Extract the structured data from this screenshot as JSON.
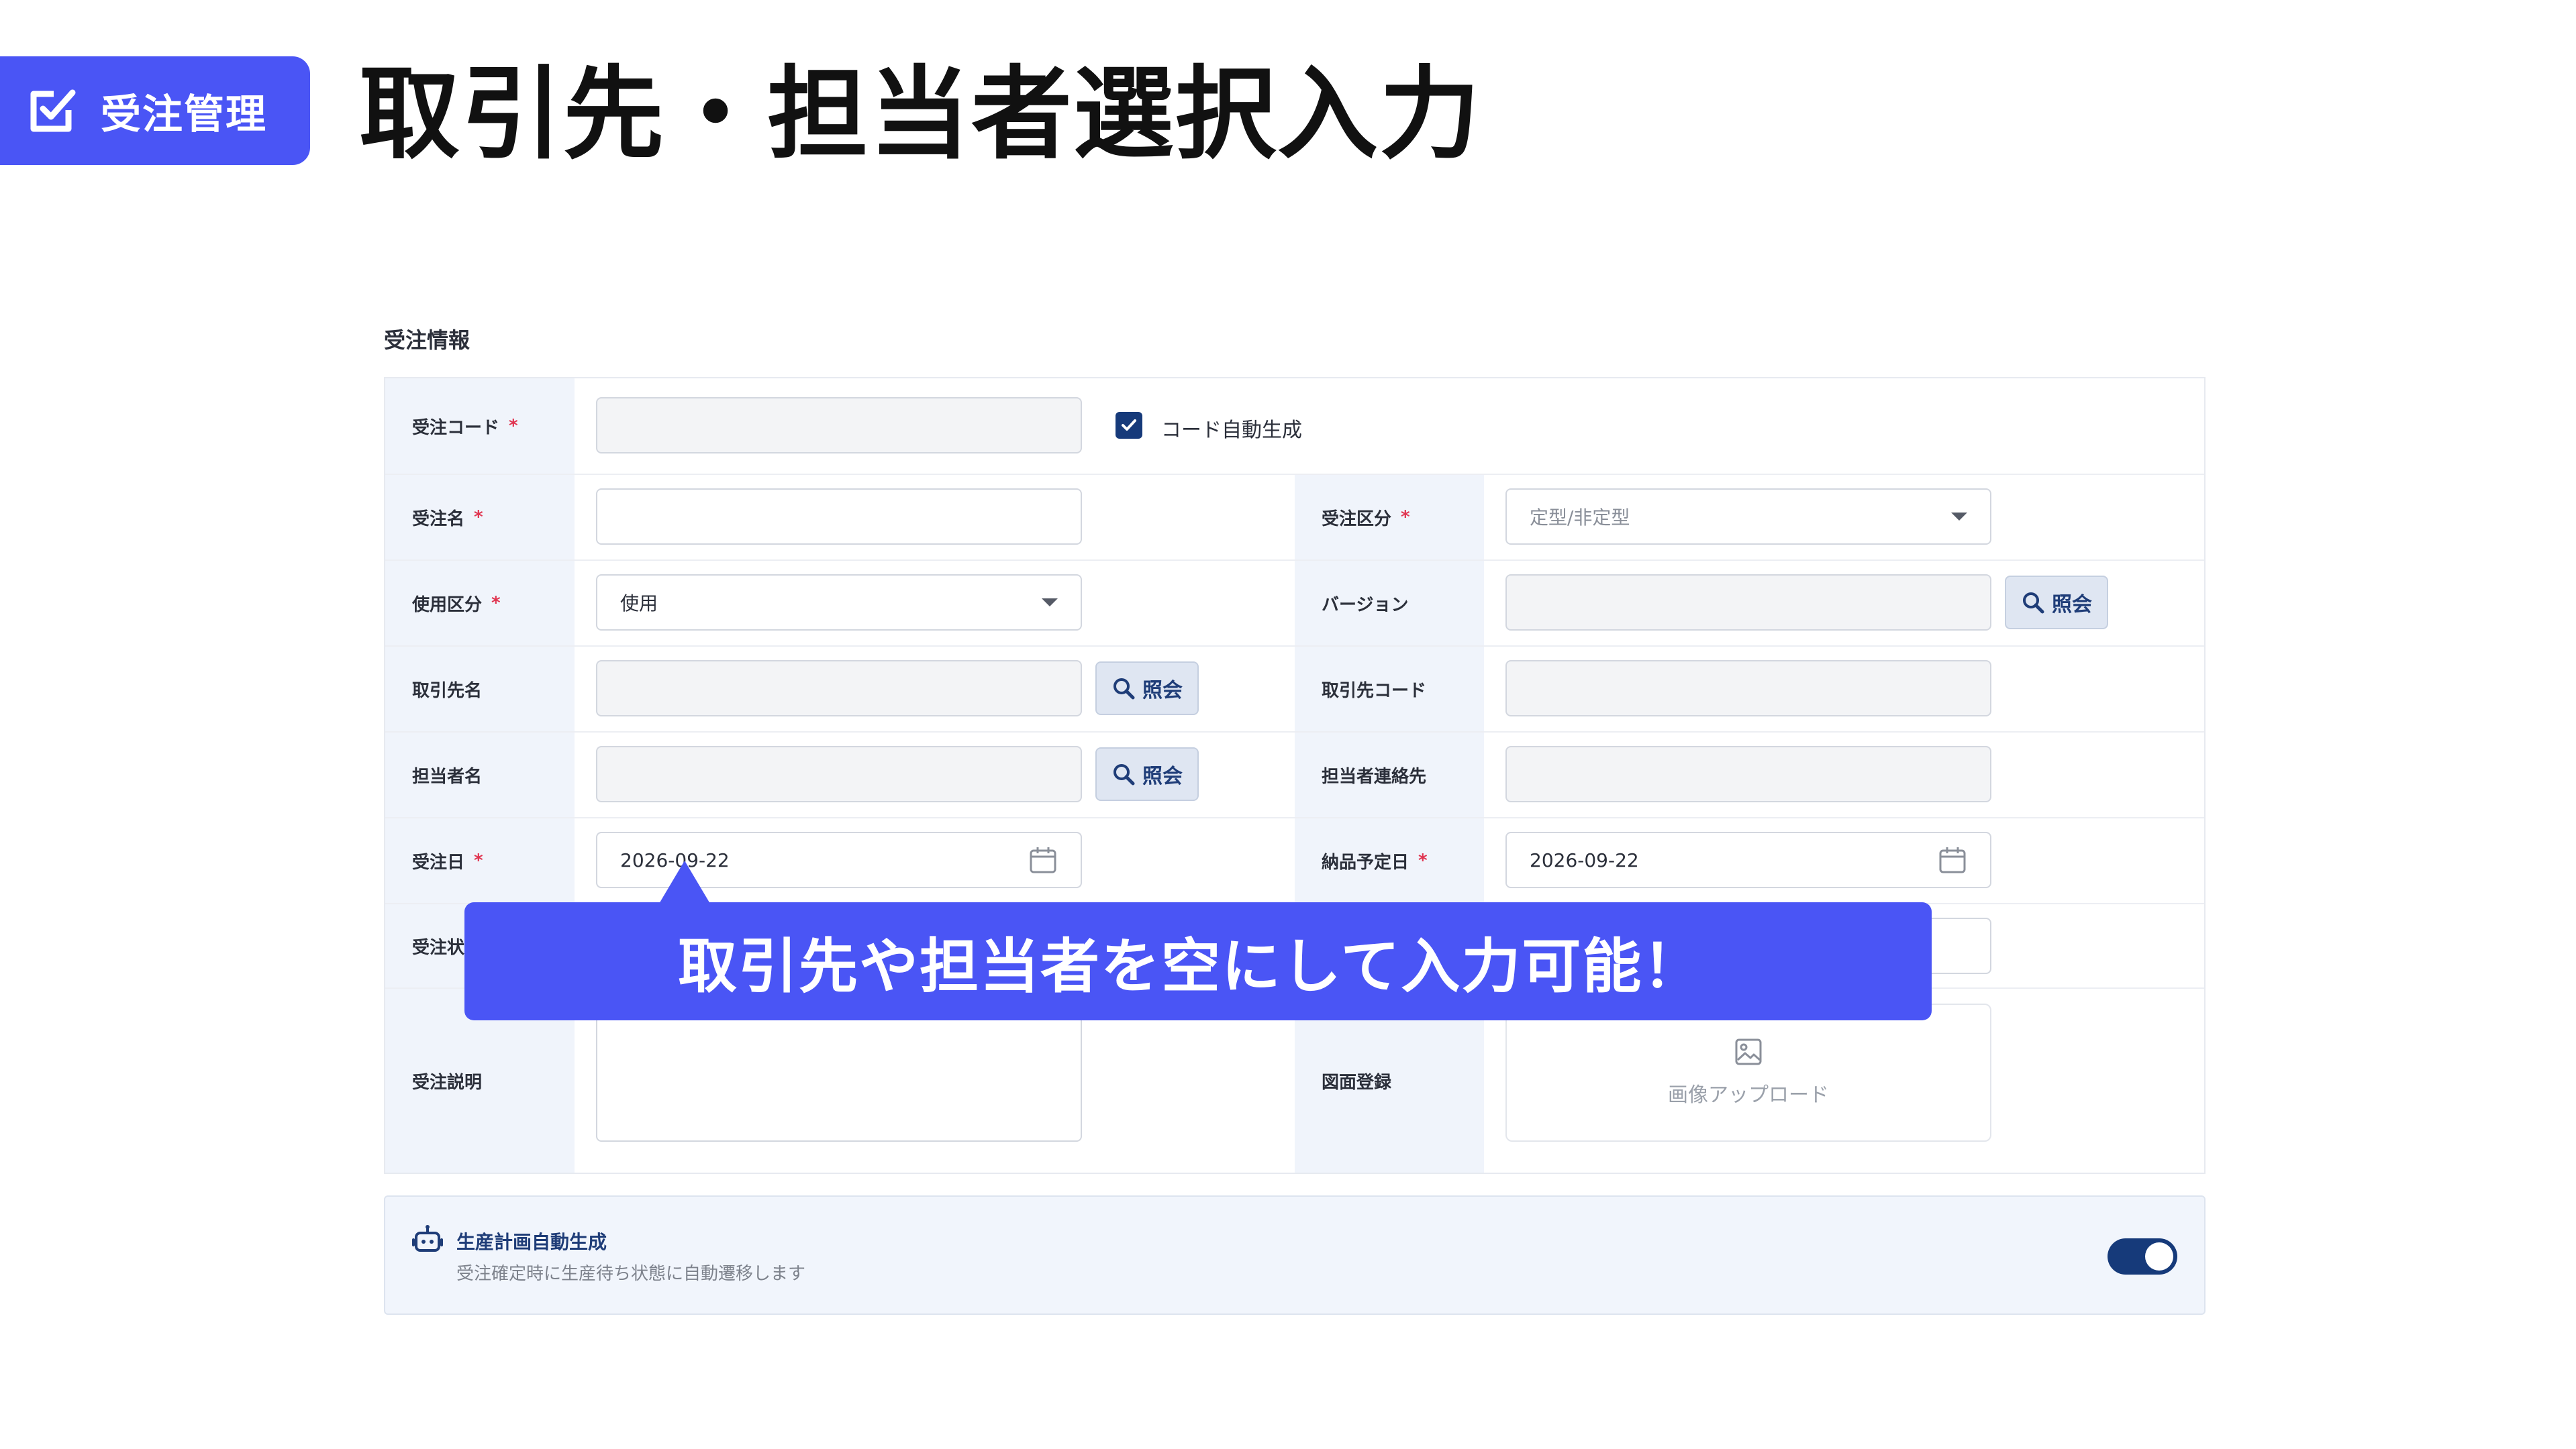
{
  "header": {
    "badge_label": "受注管理",
    "title": "取引先・担当者選択入力"
  },
  "form": {
    "section_title": "受注情報",
    "required_mark": "*",
    "order_code": {
      "label": "受注コード",
      "value": "",
      "auto_label": "コード自動生成",
      "auto_checked": true
    },
    "order_name": {
      "label": "受注名",
      "value": ""
    },
    "order_type": {
      "label": "受注区分",
      "placeholder": "定型/非定型"
    },
    "usage": {
      "label": "使用区分",
      "value": "使用"
    },
    "version": {
      "label": "バージョン",
      "value": "",
      "lookup_label": "照会"
    },
    "client_name": {
      "label": "取引先名",
      "value": "",
      "lookup_label": "照会"
    },
    "client_code": {
      "label": "取引先コード",
      "value": ""
    },
    "contact_name": {
      "label": "担当者名",
      "value": "",
      "lookup_label": "照会"
    },
    "contact_info": {
      "label": "担当者連絡先",
      "value": ""
    },
    "order_date": {
      "label": "受注日",
      "value": "2026-09-22"
    },
    "delivery_date": {
      "label": "納品予定日",
      "value": "2026-09-22"
    },
    "order_status": {
      "label": "受注状"
    },
    "description": {
      "label": "受注説明",
      "value": ""
    },
    "drawing": {
      "label": "図面登録",
      "upload_label": "画像アップロード"
    }
  },
  "auto_production": {
    "title": "生産計画自動生成",
    "description": "受注確定時に生産待ち状態に自動遷移します",
    "enabled": true
  },
  "callout": {
    "text": "取引先や担当者を空にして入力可能！"
  },
  "colors": {
    "accent": "#4a55f5",
    "navy": "#163a7a",
    "required": "#e0334f",
    "label_bg": "#f0f4fb"
  }
}
